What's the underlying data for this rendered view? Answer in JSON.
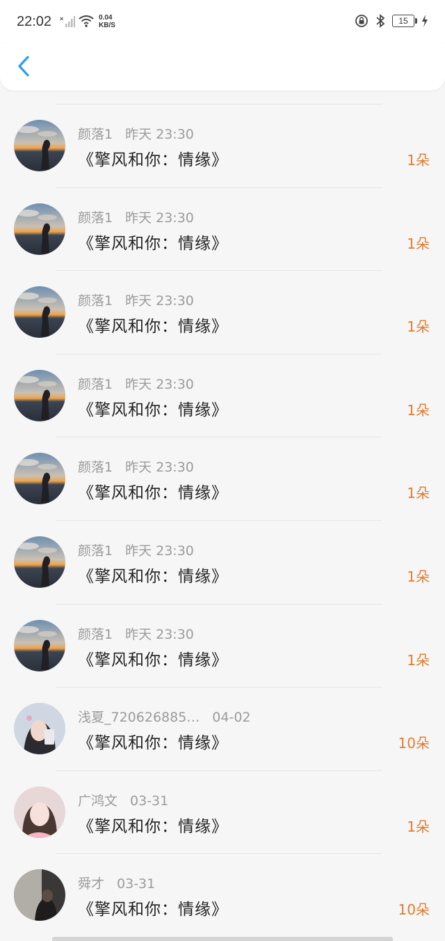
{
  "status": {
    "time": "22:02",
    "net_speed_top": "0.04",
    "net_speed_bottom": "KB/S",
    "battery": "15"
  },
  "colors": {
    "accent": "#2a9df4",
    "amount": "#e07b2e"
  },
  "items": [
    {
      "name": "颜落1",
      "date": "昨天 23:30",
      "title": "《擎风和你：情缘》",
      "amount": "1朵",
      "avatar": "sunset"
    },
    {
      "name": "颜落1",
      "date": "昨天 23:30",
      "title": "《擎风和你：情缘》",
      "amount": "1朵",
      "avatar": "sunset"
    },
    {
      "name": "颜落1",
      "date": "昨天 23:30",
      "title": "《擎风和你：情缘》",
      "amount": "1朵",
      "avatar": "sunset"
    },
    {
      "name": "颜落1",
      "date": "昨天 23:30",
      "title": "《擎风和你：情缘》",
      "amount": "1朵",
      "avatar": "sunset"
    },
    {
      "name": "颜落1",
      "date": "昨天 23:30",
      "title": "《擎风和你：情缘》",
      "amount": "1朵",
      "avatar": "sunset"
    },
    {
      "name": "颜落1",
      "date": "昨天 23:30",
      "title": "《擎风和你：情缘》",
      "amount": "1朵",
      "avatar": "sunset"
    },
    {
      "name": "颜落1",
      "date": "昨天 23:30",
      "title": "《擎风和你：情缘》",
      "amount": "1朵",
      "avatar": "sunset"
    },
    {
      "name": "浅夏_720626885…",
      "date": "04-02",
      "title": "《擎风和你：情缘》",
      "amount": "10朵",
      "avatar": "girl-selfie"
    },
    {
      "name": "广鸿文",
      "date": "03-31",
      "title": "《擎风和你：情缘》",
      "amount": "1朵",
      "avatar": "girl-pink"
    },
    {
      "name": "舜才",
      "date": "03-31",
      "title": "《擎风和你：情缘》",
      "amount": "10朵",
      "avatar": "dark-photo"
    }
  ]
}
